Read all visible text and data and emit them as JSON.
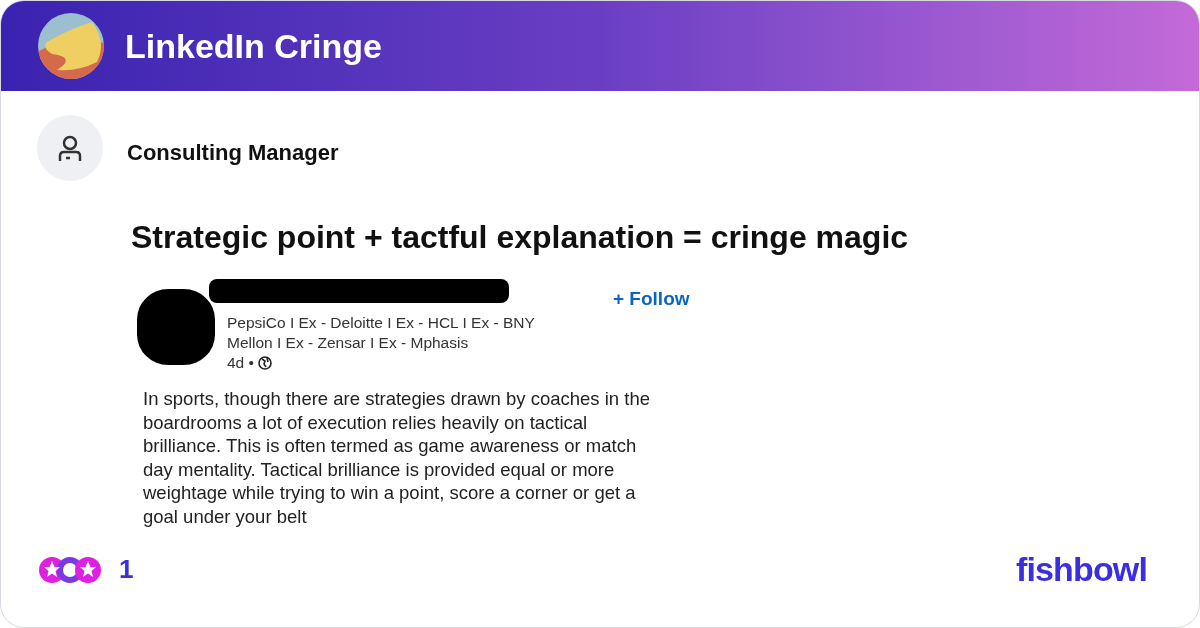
{
  "header": {
    "title": "LinkedIn Cringe"
  },
  "post": {
    "author": "Consulting Manager",
    "title": "Strategic point + tactful explanation = cringe magic",
    "screenshot": {
      "follow": "+ Follow",
      "headline": "PepsiCo I Ex - Deloitte I Ex - HCL I Ex - BNY Mellon I Ex - Zensar I Ex - Mphasis",
      "age": "4d •",
      "body": [
        "In sports, though there are strategies drawn by coaches in the",
        "boardrooms a lot of execution relies heavily on tactical",
        "brilliance. This is often termed as game awareness or match",
        "day mentality. Tactical brilliance is provided equal or more",
        "weightage while trying to win a point, score a corner or get a",
        "goal under your belt"
      ]
    }
  },
  "footer": {
    "reaction_count": "1",
    "brand": "fishbowl"
  }
}
